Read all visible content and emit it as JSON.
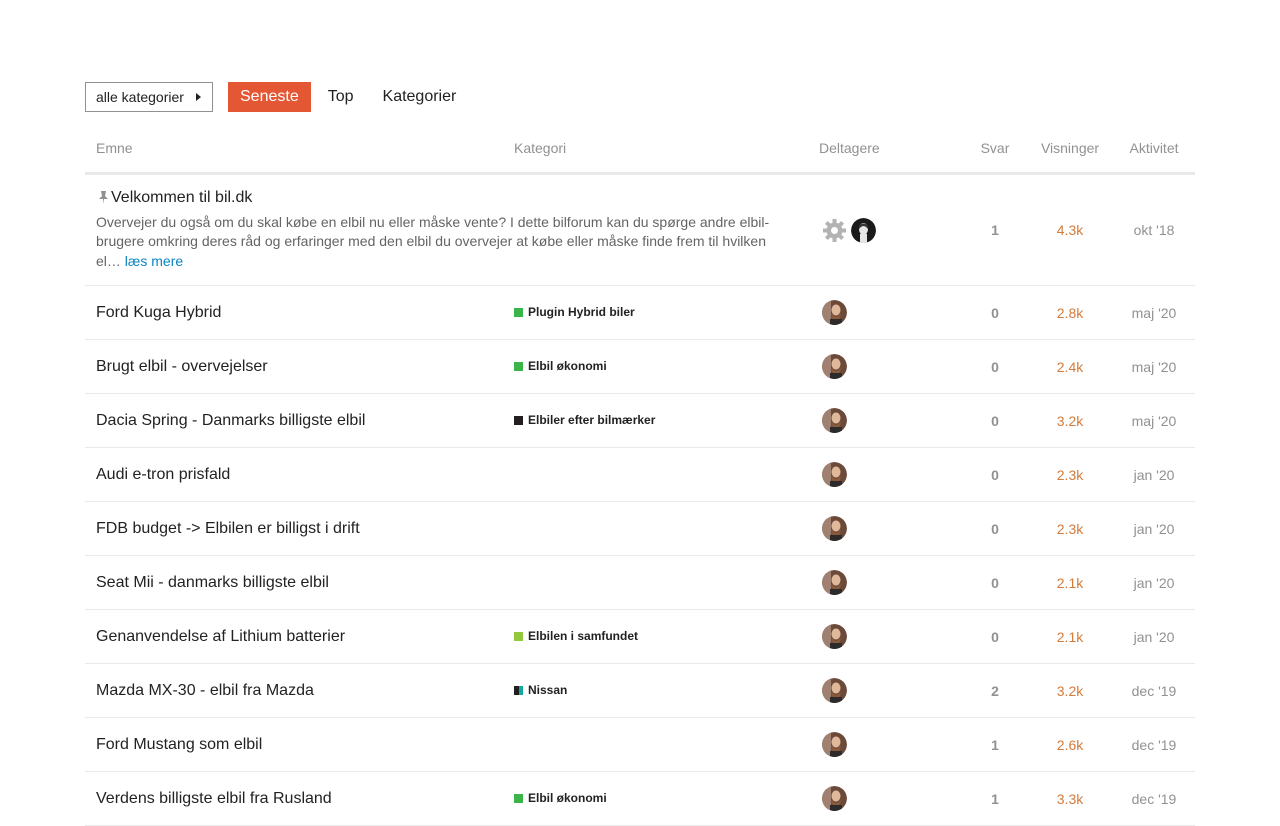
{
  "nav": {
    "category_dropdown": "alle kategorier",
    "tabs": [
      {
        "label": "Seneste",
        "active": true
      },
      {
        "label": "Top",
        "active": false
      },
      {
        "label": "Kategorier",
        "active": false
      }
    ]
  },
  "columns": {
    "topic": "Emne",
    "category": "Kategori",
    "participants": "Deltagere",
    "replies": "Svar",
    "views": "Visninger",
    "activity": "Aktivitet"
  },
  "pinned": {
    "title": "Velkommen til bil.dk",
    "excerpt": "Overvejer du også om du skal købe en elbil nu eller måske vente? I dette bilforum kan du spørge andre elbil-brugere omkring deres råd og erfaringer med den elbil du overvejer at købe eller måske finde frem til hvilken el…",
    "read_more": "læs mere",
    "replies": "1",
    "views": "4.3k",
    "activity": "okt '18",
    "icon": "pin-icon"
  },
  "topics": [
    {
      "title": "Ford Kuga Hybrid",
      "category": "Plugin Hybrid biler",
      "cat_color": "#3ab54a",
      "replies": "0",
      "views": "2.8k",
      "activity": "maj '20"
    },
    {
      "title": "Brugt elbil - overvejelser",
      "category": "Elbil økonomi",
      "cat_color": "#3ab54a",
      "replies": "0",
      "views": "2.4k",
      "activity": "maj '20"
    },
    {
      "title": "Dacia Spring - Danmarks billigste elbil",
      "category": "Elbiler efter bilmærker",
      "cat_color": "#231f20",
      "replies": "0",
      "views": "3.2k",
      "activity": "maj '20"
    },
    {
      "title": "Audi e-tron prisfald",
      "category": "",
      "cat_color": "",
      "replies": "0",
      "views": "2.3k",
      "activity": "jan '20"
    },
    {
      "title": "FDB budget -> Elbilen er billigst i drift",
      "category": "",
      "cat_color": "",
      "replies": "0",
      "views": "2.3k",
      "activity": "jan '20"
    },
    {
      "title": "Seat Mii - danmarks billigste elbil",
      "category": "",
      "cat_color": "",
      "replies": "0",
      "views": "2.1k",
      "activity": "jan '20"
    },
    {
      "title": "Genanvendelse af Lithium batterier",
      "category": "Elbilen i samfundet",
      "cat_color": "#92c83e",
      "replies": "0",
      "views": "2.1k",
      "activity": "jan '20"
    },
    {
      "title": "Mazda MX-30 - elbil fra Mazda",
      "category": "Nissan",
      "cat_color": "#231f20",
      "cat_color2": "#12a89d",
      "replies": "2",
      "views": "3.2k",
      "activity": "dec '19"
    },
    {
      "title": "Ford Mustang som elbil",
      "category": "",
      "cat_color": "",
      "replies": "1",
      "views": "2.6k",
      "activity": "dec '19"
    },
    {
      "title": "Verdens billigste elbil fra Rusland",
      "category": "Elbil økonomi",
      "cat_color": "#3ab54a",
      "replies": "1",
      "views": "3.3k",
      "activity": "dec '19"
    }
  ]
}
